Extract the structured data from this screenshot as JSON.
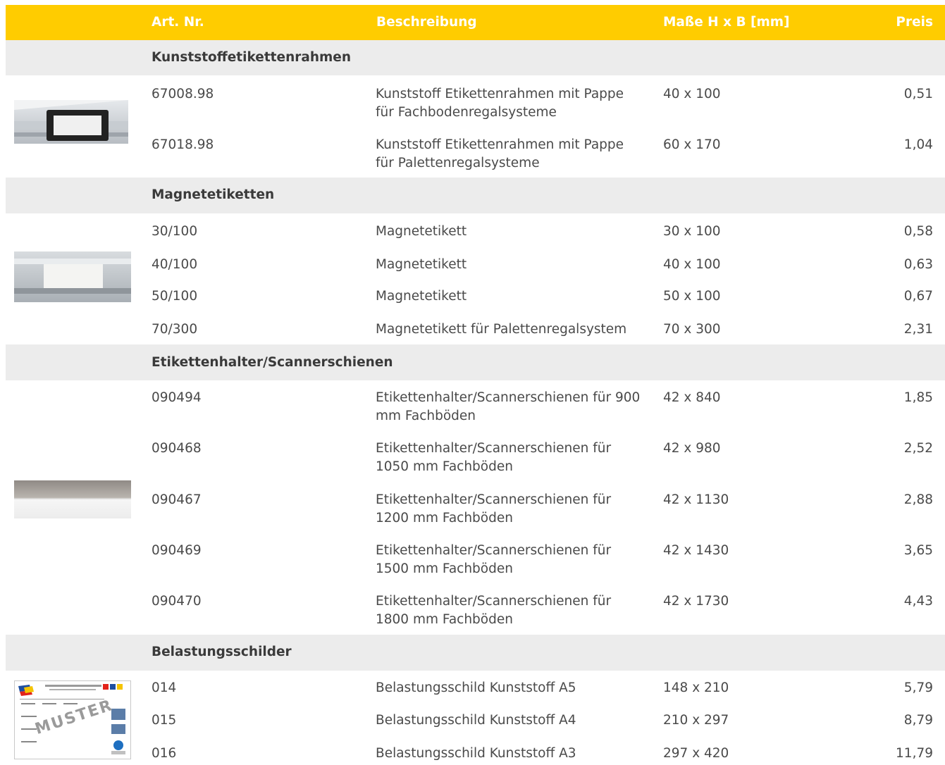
{
  "header": {
    "artnr": "Art. Nr.",
    "beschreibung": "Beschreibung",
    "masse": "Maße H x B [mm]",
    "preis": "Preis"
  },
  "sections": [
    {
      "title": "Kunststoffetikettenrahmen",
      "rows": [
        {
          "artnr": "67008.98",
          "desc": "Kunststoff Etikettenrahmen mit Pappe für Fachbodenregalsysteme",
          "dims": "40 x 100",
          "price": "0,51"
        },
        {
          "artnr": "67018.98",
          "desc": "Kunststoff Etikettenrahmen mit Pappe für Palettenregalsysteme",
          "dims": "60 x 170",
          "price": "1,04"
        }
      ]
    },
    {
      "title": "Magnetetiketten",
      "rows": [
        {
          "artnr": "30/100",
          "desc": "Magnetetikett",
          "dims": "30 x 100",
          "price": "0,58"
        },
        {
          "artnr": "40/100",
          "desc": "Magnetetikett",
          "dims": "40 x 100",
          "price": "0,63"
        },
        {
          "artnr": "50/100",
          "desc": "Magnetetikett",
          "dims": "50 x 100",
          "price": "0,67"
        },
        {
          "artnr": "70/300",
          "desc": "Magnetetikett für Palettenregalsystem",
          "dims": "70 x 300",
          "price": "2,31"
        }
      ]
    },
    {
      "title": "Etikettenhalter/Scannerschienen",
      "rows": [
        {
          "artnr": "090494",
          "desc": "Etikettenhalter/Scannerschienen für 900 mm Fachböden",
          "dims": "42 x 840",
          "price": "1,85"
        },
        {
          "artnr": "090468",
          "desc": "Etikettenhalter/Scannerschienen für 1050 mm Fachböden",
          "dims": "42 x 980",
          "price": "2,52"
        },
        {
          "artnr": "090467",
          "desc": "Etikettenhalter/Scannerschienen für 1200 mm Fachböden",
          "dims": "42 x 1130",
          "price": "2,88"
        },
        {
          "artnr": "090469",
          "desc": "Etikettenhalter/Scannerschienen für 1500 mm Fachböden",
          "dims": "42 x 1430",
          "price": "3,65"
        },
        {
          "artnr": "090470",
          "desc": "Etikettenhalter/Scannerschienen für 1800 mm Fachböden",
          "dims": "42 x 1730",
          "price": "4,43"
        }
      ]
    },
    {
      "title": "Belastungsschilder",
      "rows": [
        {
          "artnr": "014",
          "desc": "Belastungsschild Kunststoff A5",
          "dims": "148 x 210",
          "price": "5,79"
        },
        {
          "artnr": "015",
          "desc": "Belastungsschild Kunststoff A4",
          "dims": "210 x 297",
          "price": "8,79"
        },
        {
          "artnr": "016",
          "desc": "Belastungsschild Kunststoff A3",
          "dims": "297 x 420",
          "price": "11,79"
        }
      ]
    }
  ],
  "colors": {
    "accent": "#ffcc00",
    "section_bg": "#ececec",
    "text": "#4a4a4a"
  },
  "images": [
    "label-frame-photo",
    "magnet-label-photo",
    "scanner-rail-photo",
    "load-sign-muster-photo"
  ],
  "watermark": "MUSTER"
}
